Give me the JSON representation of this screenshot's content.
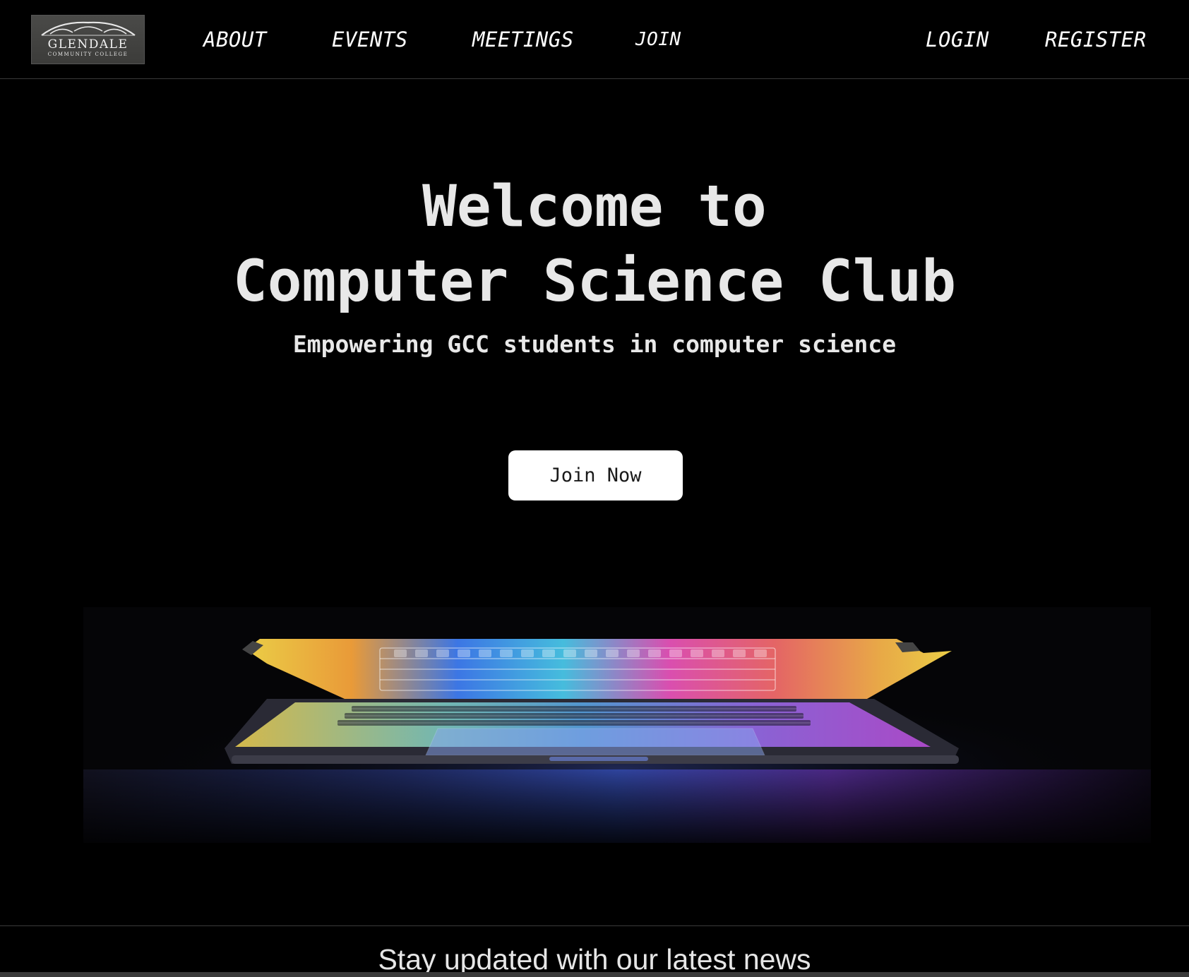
{
  "logo": {
    "name": "GLENDALE",
    "subtitle": "COMMUNITY COLLEGE"
  },
  "nav": {
    "about": "ABOUT",
    "events": "EVENTS",
    "meetings": "MEETINGS",
    "join": "JOIN",
    "login": "LOGIN",
    "register": "REGISTER"
  },
  "hero": {
    "title_line1": "Welcome to",
    "title_line2": "Computer Science Club",
    "subtitle": "Empowering GCC students in computer science",
    "cta_label": "Join Now"
  },
  "news": {
    "title": "Stay updated with our latest news"
  },
  "colors": {
    "background": "#000000",
    "text": "#e8e8e8",
    "button_bg": "#ffffff",
    "button_text": "#1a1a1a"
  }
}
